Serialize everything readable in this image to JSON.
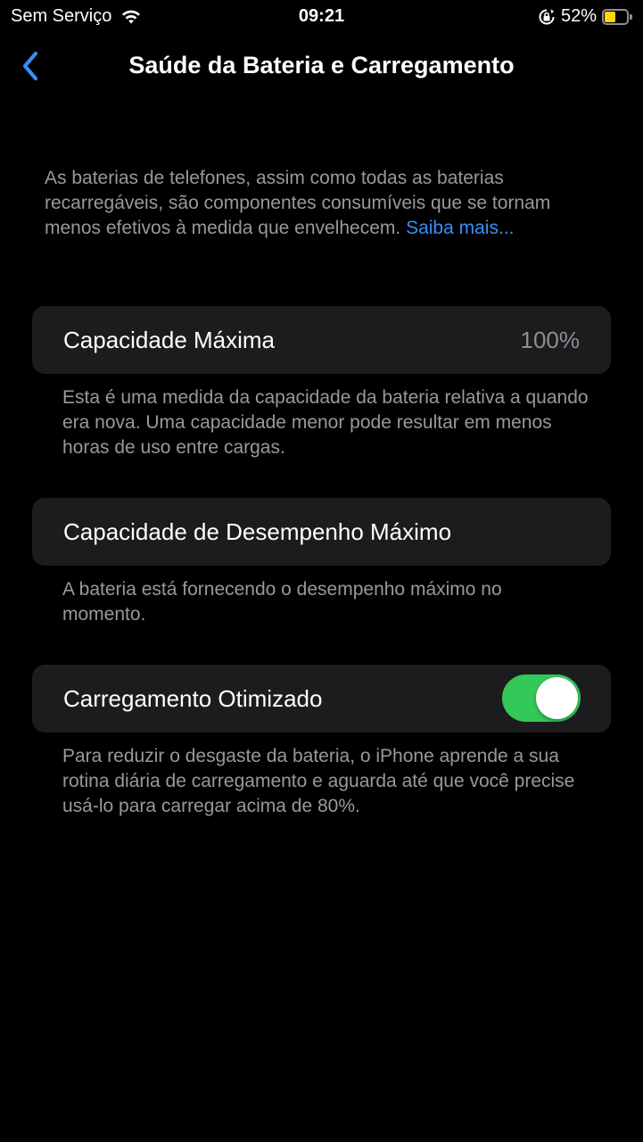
{
  "status_bar": {
    "carrier": "Sem Serviço",
    "time": "09:21",
    "battery_percent_label": "52%",
    "battery_level": 0.52,
    "battery_color": "#ffd60a"
  },
  "nav": {
    "back_icon": "chevron-left-icon",
    "title": "Saúde da Bateria e Carregamento"
  },
  "intro": {
    "text": "As baterias de telefones, assim como todas as baterias recarregáveis, são componentes consumíveis que se tornam menos efetivos à medida que envelhecem. ",
    "link_text": "Saiba mais..."
  },
  "sections": {
    "max_capacity": {
      "label": "Capacidade Máxima",
      "value": "100%",
      "footnote": "Esta é uma medida da capacidade da bateria relativa a quando era nova. Uma capacidade menor pode resultar em menos horas de uso entre cargas."
    },
    "peak_performance": {
      "label": "Capacidade de Desempenho Máximo",
      "footnote": "A bateria está fornecendo o desempenho máximo no momento."
    },
    "optimized_charging": {
      "label": "Carregamento Otimizado",
      "enabled": true,
      "footnote": "Para reduzir o desgaste da bateria, o iPhone aprende a sua rotina diária de carregamento e aguarda até que você precise usá-lo para carregar acima de 80%."
    }
  },
  "colors": {
    "background": "#000000",
    "cell_background": "#1c1c1e",
    "accent_link": "#3a8ef6",
    "toggle_on": "#34c759",
    "secondary_text": "#98989f"
  }
}
